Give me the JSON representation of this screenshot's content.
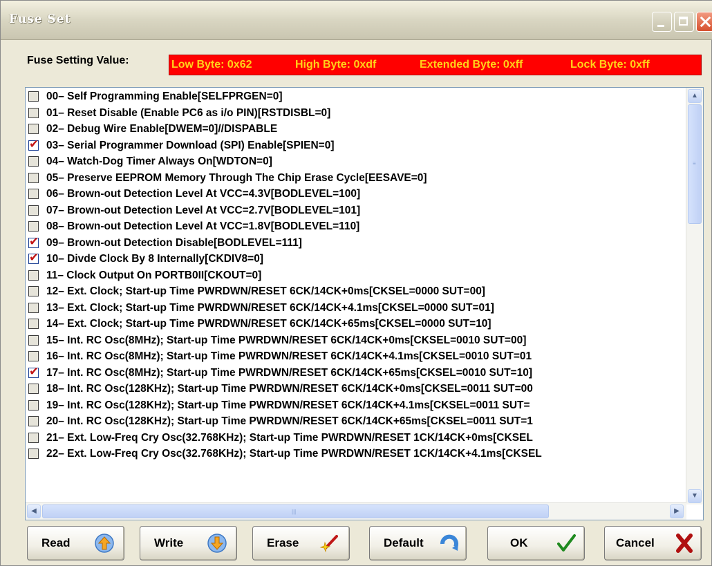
{
  "window": {
    "title": "Fuse Set"
  },
  "fuse": {
    "label": "Fuse Setting Value:",
    "low": "Low Byte: 0x62",
    "high": "High Byte: 0xdf",
    "extended": "Extended Byte: 0xff",
    "lock": "Lock Byte: 0xff"
  },
  "options": [
    {
      "label": "00– Self Programming Enable[SELFPRGEN=0]",
      "checked": false
    },
    {
      "label": "01– Reset Disable (Enable PC6 as i/o PIN)[RSTDISBL=0]",
      "checked": false
    },
    {
      "label": "02– Debug Wire Enable[DWEM=0]//DISPABLE",
      "checked": false
    },
    {
      "label": "03– Serial Programmer Download (SPI) Enable[SPIEN=0]",
      "checked": true
    },
    {
      "label": "04– Watch-Dog Timer Always On[WDTON=0]",
      "checked": false
    },
    {
      "label": "05– Preserve EEPROM Memory Through The Chip Erase Cycle[EESAVE=0]",
      "checked": false
    },
    {
      "label": "06– Brown-out Detection Level At VCC=4.3V[BODLEVEL=100]",
      "checked": false
    },
    {
      "label": "07– Brown-out Detection Level At VCC=2.7V[BODLEVEL=101]",
      "checked": false
    },
    {
      "label": "08– Brown-out Detection Level At VCC=1.8V[BODLEVEL=110]",
      "checked": false
    },
    {
      "label": "09– Brown-out Detection Disable[BODLEVEL=111]",
      "checked": true
    },
    {
      "label": "10– Divde Clock By 8 Internally[CKDIV8=0]",
      "checked": true
    },
    {
      "label": "11– Clock Output On PORTB0II[CKOUT=0]",
      "checked": false
    },
    {
      "label": "12– Ext. Clock; Start-up Time PWRDWN/RESET 6CK/14CK+0ms[CKSEL=0000 SUT=00]",
      "checked": false
    },
    {
      "label": "13– Ext. Clock; Start-up Time PWRDWN/RESET 6CK/14CK+4.1ms[CKSEL=0000 SUT=01]",
      "checked": false
    },
    {
      "label": "14– Ext. Clock; Start-up Time PWRDWN/RESET 6CK/14CK+65ms[CKSEL=0000 SUT=10]",
      "checked": false
    },
    {
      "label": "15– Int. RC Osc(8MHz); Start-up Time PWRDWN/RESET 6CK/14CK+0ms[CKSEL=0010 SUT=00]",
      "checked": false
    },
    {
      "label": "16– Int. RC Osc(8MHz); Start-up Time PWRDWN/RESET 6CK/14CK+4.1ms[CKSEL=0010 SUT=01",
      "checked": false
    },
    {
      "label": "17– Int. RC Osc(8MHz); Start-up Time PWRDWN/RESET 6CK/14CK+65ms[CKSEL=0010 SUT=10]",
      "checked": true
    },
    {
      "label": "18– Int. RC Osc(128KHz); Start-up Time PWRDWN/RESET 6CK/14CK+0ms[CKSEL=0011 SUT=00",
      "checked": false
    },
    {
      "label": "19– Int. RC Osc(128KHz); Start-up Time PWRDWN/RESET 6CK/14CK+4.1ms[CKSEL=0011 SUT=",
      "checked": false
    },
    {
      "label": "20– Int. RC Osc(128KHz); Start-up Time PWRDWN/RESET 6CK/14CK+65ms[CKSEL=0011 SUT=1",
      "checked": false
    },
    {
      "label": "21– Ext. Low-Freq Cry Osc(32.768KHz); Start-up Time PWRDWN/RESET 1CK/14CK+0ms[CKSEL",
      "checked": false
    },
    {
      "label": "22– Ext. Low-Freq Cry Osc(32.768KHz); Start-up Time PWRDWN/RESET 1CK/14CK+4.1ms[CKSEL",
      "checked": false
    }
  ],
  "buttons": {
    "read": "Read",
    "write": "Write",
    "erase": "Erase",
    "default": "Default",
    "ok": "OK",
    "cancel": "Cancel"
  },
  "icons": {
    "read": "arrow-up-icon",
    "write": "arrow-down-icon",
    "erase": "magic-wand-icon",
    "default": "refresh-icon",
    "ok": "checkmark-icon",
    "cancel": "x-mark-icon"
  },
  "colors": {
    "fuse_bg": "#ff0000",
    "fuse_text": "#ffd21a",
    "check": "#c31616",
    "dialog_bg": "#ECE9D8"
  }
}
